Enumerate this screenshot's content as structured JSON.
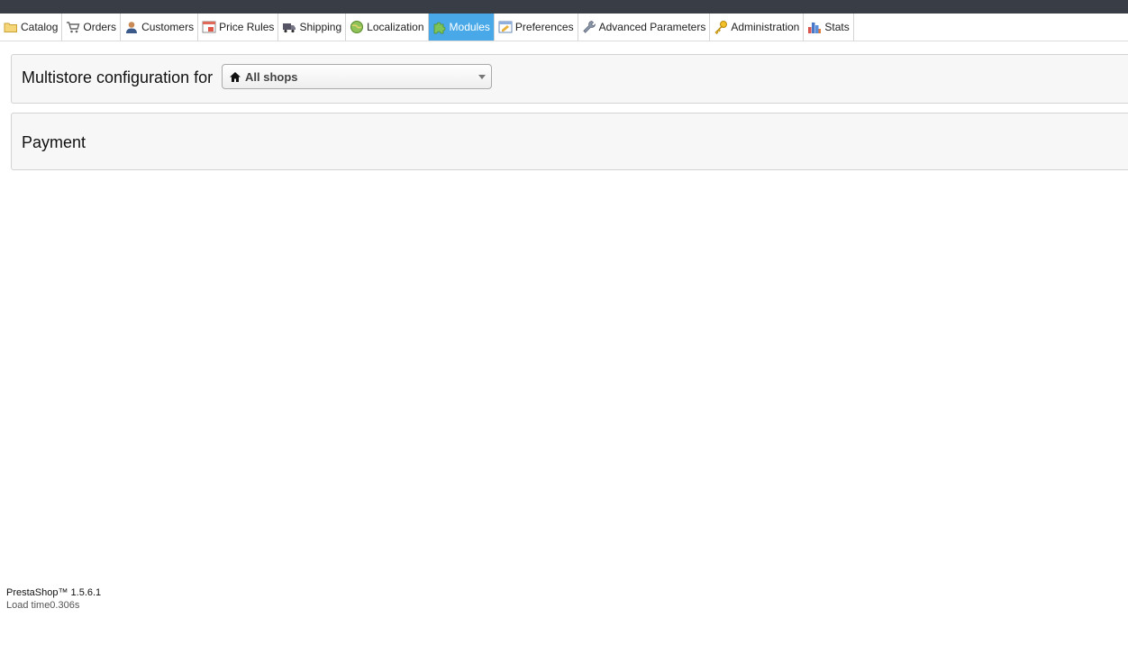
{
  "nav": {
    "tabs": [
      {
        "label": "Catalog",
        "icon": "folder-icon",
        "active": false
      },
      {
        "label": "Orders",
        "icon": "cart-icon",
        "active": false
      },
      {
        "label": "Customers",
        "icon": "user-icon",
        "active": false
      },
      {
        "label": "Price Rules",
        "icon": "price-tag-icon",
        "active": false
      },
      {
        "label": "Shipping",
        "icon": "truck-icon",
        "active": false
      },
      {
        "label": "Localization",
        "icon": "globe-icon",
        "active": false
      },
      {
        "label": "Modules",
        "icon": "puzzle-icon",
        "active": true
      },
      {
        "label": "Preferences",
        "icon": "preferences-icon",
        "active": false
      },
      {
        "label": "Advanced Parameters",
        "icon": "wrench-icon",
        "active": false
      },
      {
        "label": "Administration",
        "icon": "key-icon",
        "active": false
      },
      {
        "label": "Stats",
        "icon": "bar-chart-icon",
        "active": false
      }
    ]
  },
  "multistore": {
    "label": "Multistore configuration for",
    "selected": "All shops"
  },
  "payment": {
    "title": "Payment"
  },
  "footer": {
    "version": "PrestaShop™ 1.5.6.1",
    "load_time": "Load time0.306s"
  },
  "colors": {
    "topbar": "#393e46",
    "active_tab": "#49a9e8",
    "panel_bg": "#f7f7f7"
  }
}
